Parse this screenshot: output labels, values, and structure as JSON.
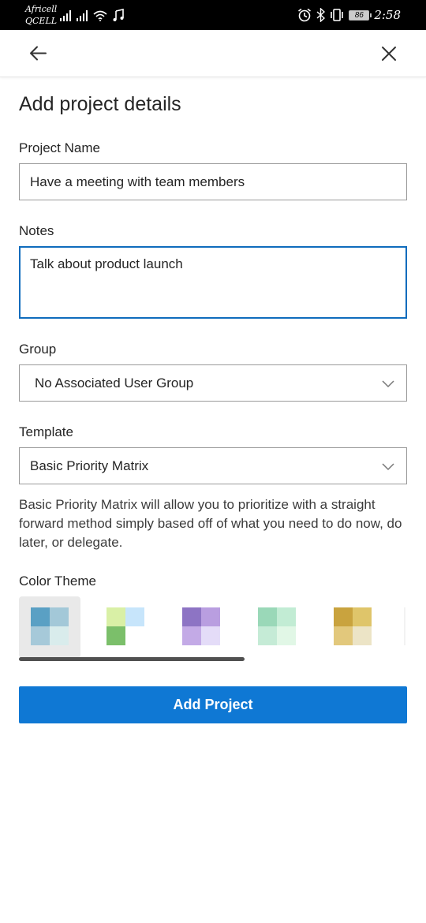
{
  "status_bar": {
    "carrier_line1": "Africell",
    "carrier_line2": "QCELL",
    "battery": "86",
    "time": "2:58",
    "icons": [
      "signal-icon",
      "signal-icon",
      "wifi-icon",
      "music-icon",
      "alarm-icon",
      "bluetooth-icon",
      "vibrate-icon",
      "battery-icon"
    ]
  },
  "top_bar": {
    "back_icon": "arrow-left-icon",
    "close_icon": "close-icon"
  },
  "form": {
    "title": "Add project details",
    "project_name_label": "Project Name",
    "project_name_value": "Have a meeting with team members",
    "notes_label": "Notes",
    "notes_value": "Talk about product launch",
    "group_label": "Group",
    "group_value": "No Associated User Group",
    "template_label": "Template",
    "template_value": "Basic Priority Matrix",
    "template_description": "Basic Priority Matrix will allow you to prioritize with a straight forward method simply based off of what you need to do now, do later, or delegate.",
    "color_theme_label": "Color Theme",
    "submit_label": "Add Project"
  },
  "color_themes": [
    {
      "name": "blue",
      "selected": true,
      "colors": [
        "#5aa0c4",
        "#a3c8d8",
        "#a6c9d9",
        "#d9ecec"
      ]
    },
    {
      "name": "lime-green",
      "selected": false,
      "colors": [
        "#d9f0a6",
        "#c7e5fb",
        "#7bbf6a",
        "#ffffff"
      ]
    },
    {
      "name": "purple",
      "selected": false,
      "colors": [
        "#8d74c4",
        "#b99ee0",
        "#c3aae6",
        "#e4dcf8"
      ]
    },
    {
      "name": "mint",
      "selected": false,
      "colors": [
        "#9ad8b8",
        "#c2ecd4",
        "#c5ebd6",
        "#e1f7e6"
      ]
    },
    {
      "name": "gold",
      "selected": false,
      "colors": [
        "#c9a33e",
        "#dfc56a",
        "#e2c87c",
        "#ece4c6"
      ]
    }
  ],
  "accent_color": "#0f78d4"
}
